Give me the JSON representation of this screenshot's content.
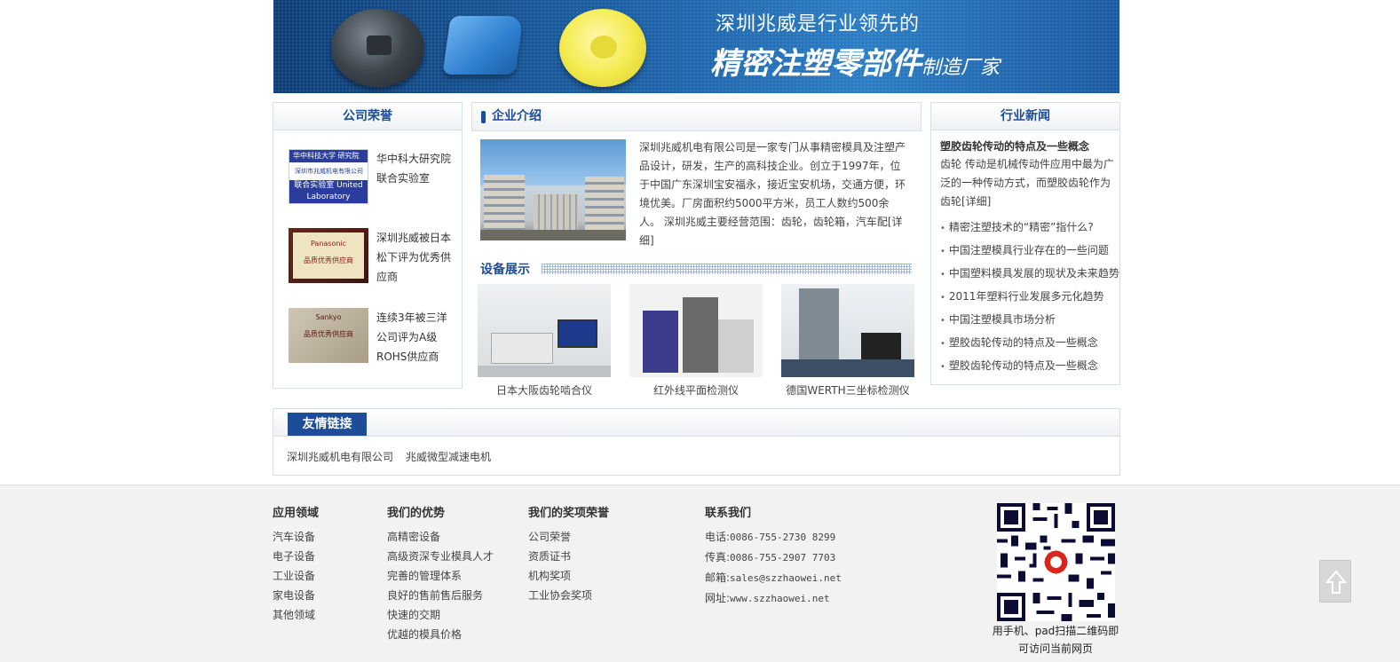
{
  "banner": {
    "slogan_top": "深圳兆威是行业领先的",
    "slogan_main": "精密注塑零部件",
    "slogan_tail": "制造厂家"
  },
  "honors": {
    "title": "公司荣誉",
    "items": [
      {
        "text": "华中科大研究院联合实验室",
        "img_lines": [
          "华中科技大学 研究院",
          "深圳市兆威机电有限公司",
          "联合实验室 United Laboratory"
        ]
      },
      {
        "text": "深圳兆威被日本松下评为优秀供应商",
        "img_lines": [
          "Panasonic",
          "品质优秀供应商"
        ]
      },
      {
        "text": "连续3年被三洋公司评为A级ROHS供应商",
        "img_lines": [
          "Sankyo",
          "品质优秀供应商"
        ]
      }
    ]
  },
  "intro": {
    "title": "企业介绍",
    "text": "深圳兆威机电有限公司是一家专门从事精密模具及注塑产品设计，研发，生产的高科技企业。创立于1997年，位于中国广东深圳宝安福永，接近宝安机场，交通方便，环境优美。厂房面积约5000平方米，员工人数约500余人。 深圳兆威主要经营范围：齿轮，齿轮箱，汽车配[详细]"
  },
  "equipment": {
    "title": "设备展示",
    "items": [
      {
        "caption": "日本大阪齿轮啮合仪"
      },
      {
        "caption": "红外线平面检测仪"
      },
      {
        "caption": "德国WERTH三坐标检测仪"
      }
    ]
  },
  "news": {
    "title": "行业新闻",
    "lead_title": "塑胶齿轮传动的特点及一些概念",
    "lead_text": "齿轮 传动是机械传动件应用中最为广泛的一种传动方式，而塑胶齿轮作为齿轮[详细]",
    "items": [
      "精密注塑技术的“精密”指什么?",
      "中国注塑模具行业存在的一些问题",
      "中国塑料模具发展的现状及未来趋势",
      "2011年塑料行业发展多元化趋势",
      "中国注塑模具市场分析",
      "塑胶齿轮传动的特点及一些概念",
      "塑胶齿轮传动的特点及一些概念"
    ]
  },
  "links": {
    "title": "友情链接",
    "items": [
      "深圳兆威机电有限公司",
      "兆威微型减速电机"
    ]
  },
  "footer": {
    "col1": {
      "title": "应用领域",
      "items": [
        "汽车设备",
        "电子设备",
        "工业设备",
        "家电设备",
        "其他领域"
      ]
    },
    "col2": {
      "title": "我们的优势",
      "items": [
        "高精密设备",
        "高级资深专业模具人才",
        "完善的管理体系",
        "良好的售前售后服务",
        "快速的交期",
        "优越的模具价格"
      ]
    },
    "col3": {
      "title": "我们的奖项荣誉",
      "items": [
        "公司荣誉",
        "资质证书",
        "机构奖项",
        "工业协会奖项"
      ]
    },
    "col4": {
      "title": "联系我们",
      "items": [
        {
          "label": "电话:",
          "value": "0086-755-2730 8299"
        },
        {
          "label": "传真:",
          "value": "0086-755-2907 7703"
        },
        {
          "label": "邮箱:",
          "value": "sales@szzhaowei.net"
        },
        {
          "label": "网址:",
          "value": "www.szzhaowei.net"
        }
      ]
    },
    "qr_text_1": "用手机、pad扫描二维码即",
    "qr_text_2": "可访问当前网页"
  },
  "icons": {
    "back_to_top": "arrow-up-icon",
    "qr": "qr-code"
  },
  "colors": {
    "brand_blue": "#1d4d96",
    "footer_bg": "#f2f2f2"
  }
}
